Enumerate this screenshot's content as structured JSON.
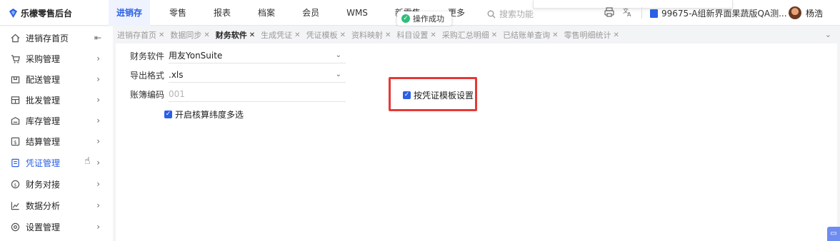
{
  "app": {
    "title": "乐檬零售后台"
  },
  "nav": {
    "items": [
      {
        "label": "进销存",
        "active": true
      },
      {
        "label": "零售"
      },
      {
        "label": "报表"
      },
      {
        "label": "档案"
      },
      {
        "label": "会员"
      },
      {
        "label": "WMS"
      },
      {
        "label": "新零售"
      },
      {
        "label": "更多"
      }
    ]
  },
  "toast": {
    "message": "操作成功"
  },
  "search": {
    "placeholder": "搜索功能"
  },
  "header": {
    "store": "99675-A组新界面果蔬版QA测...",
    "user": "杨浩"
  },
  "sidebar": {
    "items": [
      {
        "label": "进销存首页",
        "icon": "home-icon",
        "collapse": "⇤"
      },
      {
        "label": "采购管理",
        "icon": "cart-icon"
      },
      {
        "label": "配送管理",
        "icon": "delivery-icon"
      },
      {
        "label": "批发管理",
        "icon": "wholesale-icon"
      },
      {
        "label": "库存管理",
        "icon": "inventory-icon"
      },
      {
        "label": "结算管理",
        "icon": "settlement-icon"
      },
      {
        "label": "凭证管理",
        "icon": "voucher-icon",
        "active": true
      },
      {
        "label": "财务对接",
        "icon": "finance-icon"
      },
      {
        "label": "数据分析",
        "icon": "chart-icon"
      },
      {
        "label": "设置管理",
        "icon": "settings-icon"
      }
    ]
  },
  "tabs": [
    {
      "label": "进销存首页"
    },
    {
      "label": "数据同步"
    },
    {
      "label": "财务软件",
      "active": true
    },
    {
      "label": "生成凭证"
    },
    {
      "label": "凭证模板"
    },
    {
      "label": "资料映射"
    },
    {
      "label": "科目设置"
    },
    {
      "label": "采购汇总明细"
    },
    {
      "label": "已结账单查询"
    },
    {
      "label": "零售明细统计"
    }
  ],
  "form": {
    "software": {
      "label": "财务软件",
      "value": "用友YonSuite"
    },
    "export_format": {
      "label": "导出格式",
      "value": ".xls"
    },
    "ledger_code": {
      "label": "账簿编码",
      "placeholder": "001"
    },
    "multi_dim": {
      "label": "开启核算纬度多选",
      "checked": true
    },
    "by_template": {
      "label": "按凭证模板设置",
      "checked": true
    }
  },
  "colors": {
    "accent": "#2b5fe6",
    "highlight": "#e53935",
    "success": "#2fbd7a"
  }
}
